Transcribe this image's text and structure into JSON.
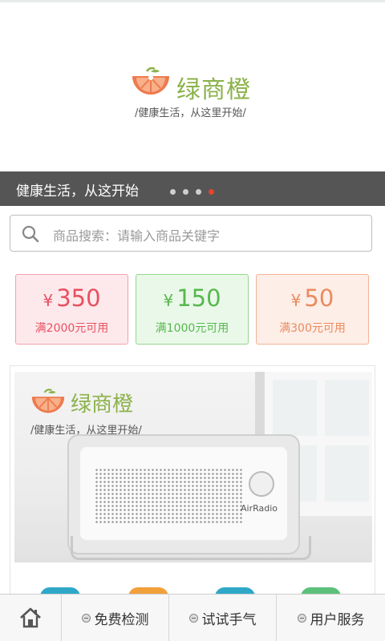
{
  "banner": {
    "brand_name": "绿商橙",
    "slogan": "/健康生活，从这里开始/",
    "caption": "健康生活，从这开始",
    "slide_count": 4,
    "active_slide": 4,
    "colors": {
      "brand_green": "#8bb24a",
      "orange": "#ee7a4e",
      "caption_bg": "#555555",
      "active_dot": "#e8432f"
    }
  },
  "search": {
    "placeholder": "商品搜索：请输入商品关键字",
    "icon": "search-icon"
  },
  "coupons": [
    {
      "yen": "¥",
      "amount": "350",
      "condition": "满2000元可用",
      "color": "#e8505f"
    },
    {
      "yen": "¥",
      "amount": "150",
      "condition": "满1000元可用",
      "color": "#56b84c"
    },
    {
      "yen": "¥",
      "amount": "50",
      "condition": "满300元可用",
      "color": "#ec8a5e"
    }
  ],
  "product": {
    "logo_name": "绿商橙",
    "logo_slogan": "/健康生活，从这里开始/",
    "device_label": "AirRadio"
  },
  "nav": {
    "home_icon": "home-icon",
    "items": [
      {
        "label": "免费检测"
      },
      {
        "label": "试试手气"
      },
      {
        "label": "用户服务"
      }
    ]
  }
}
